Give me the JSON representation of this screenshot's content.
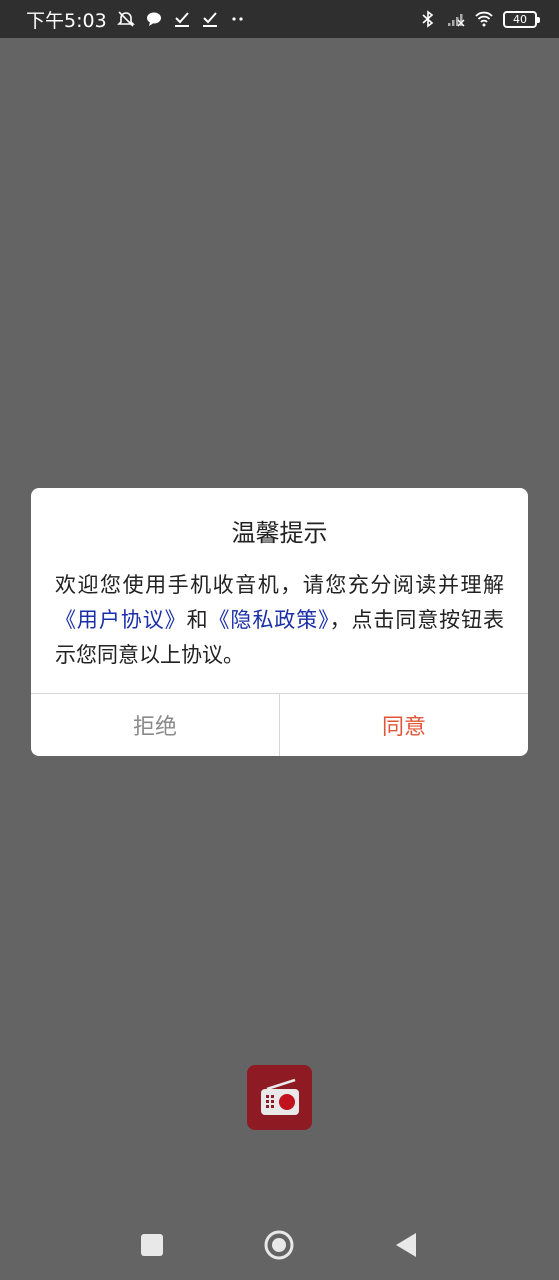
{
  "status_bar": {
    "time": "下午5:03",
    "battery": "40",
    "icons": [
      "alarm-off-icon",
      "chat-bubble-icon",
      "check-icon",
      "check-icon",
      "more-dots-icon",
      "bluetooth-icon",
      "signal-icon",
      "wifi-icon",
      "battery-icon"
    ]
  },
  "dialog": {
    "title": "温馨提示",
    "body_prefix": "欢迎您使用手机收音机，请您充分阅读并理解",
    "link_user_agreement": "《用户协议》",
    "body_and": "和",
    "link_privacy_policy": "《隐私政策》",
    "body_suffix": "，点击同意按钮表示您同意以上协议。",
    "reject_label": "拒绝",
    "agree_label": "同意"
  },
  "colors": {
    "backdrop": "#646464",
    "link": "#1a2fa8",
    "agree": "#e0563a",
    "reject": "#8a8a8a",
    "logo": "#8e1a24"
  },
  "app_logo": {
    "icon": "radio-icon"
  },
  "nav_bar": {
    "icons": [
      "recents-square-icon",
      "home-circle-icon",
      "back-triangle-icon"
    ]
  }
}
